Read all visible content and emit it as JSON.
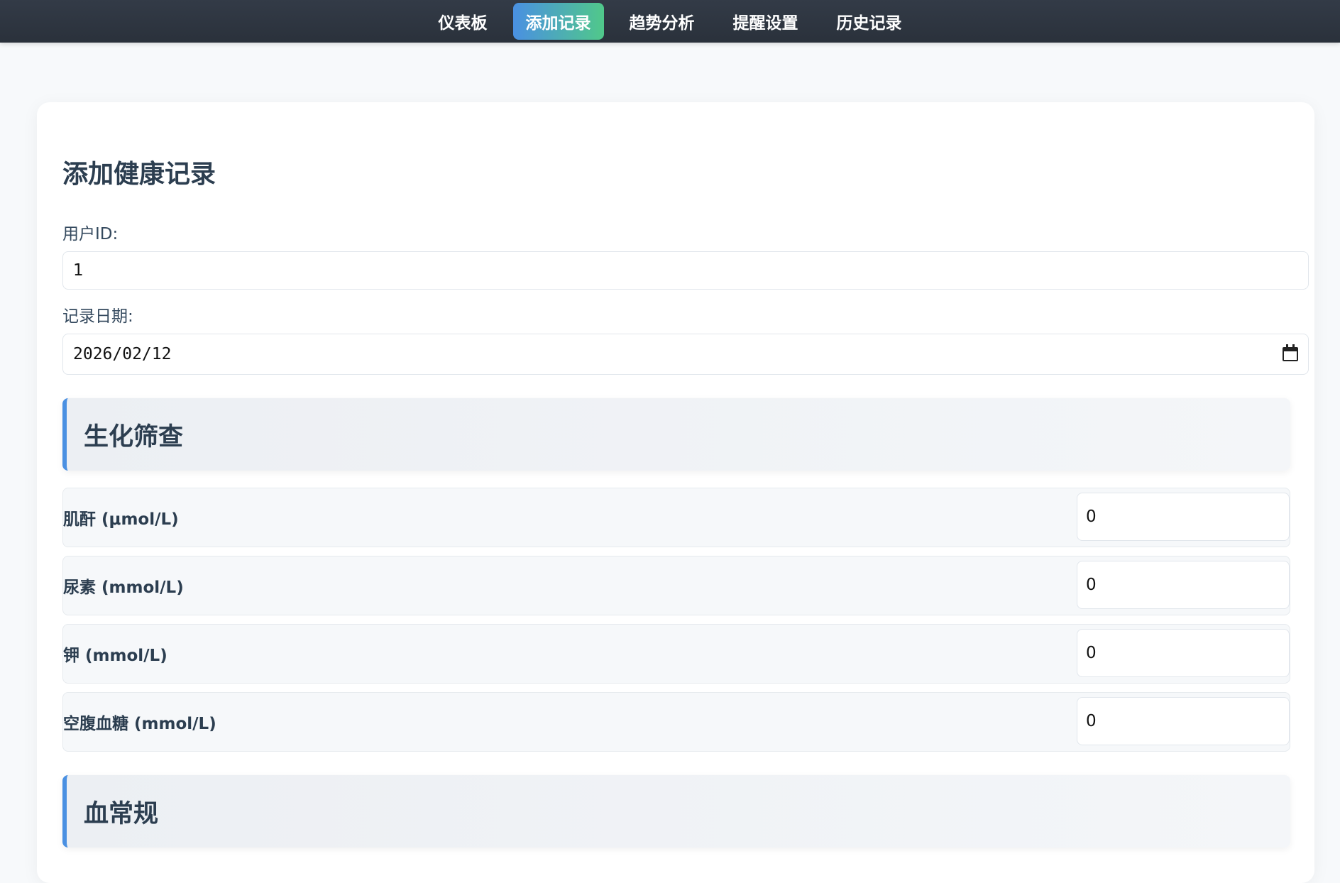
{
  "nav": {
    "items": [
      {
        "label": "仪表板"
      },
      {
        "label": "添加记录"
      },
      {
        "label": "趋势分析"
      },
      {
        "label": "提醒设置"
      },
      {
        "label": "历史记录"
      }
    ],
    "active_index": 1
  },
  "form": {
    "title": "添加健康记录",
    "user_id_label": "用户ID:",
    "user_id_value": "1",
    "date_label": "记录日期:",
    "date_value": "2026/02/12"
  },
  "sections": [
    {
      "title": "生化筛查",
      "metrics": [
        {
          "label": "肌酐 (μmol/L)",
          "value": "0"
        },
        {
          "label": "尿素 (mmol/L)",
          "value": "0"
        },
        {
          "label": "钾 (mmol/L)",
          "value": "0"
        },
        {
          "label": "空腹血糖 (mmol/L)",
          "value": "0"
        }
      ]
    },
    {
      "title": "血常规",
      "metrics": []
    }
  ],
  "colors": {
    "accent_start": "#4a90e2",
    "accent_end": "#50c88a",
    "nav_bg": "#2f3641"
  }
}
